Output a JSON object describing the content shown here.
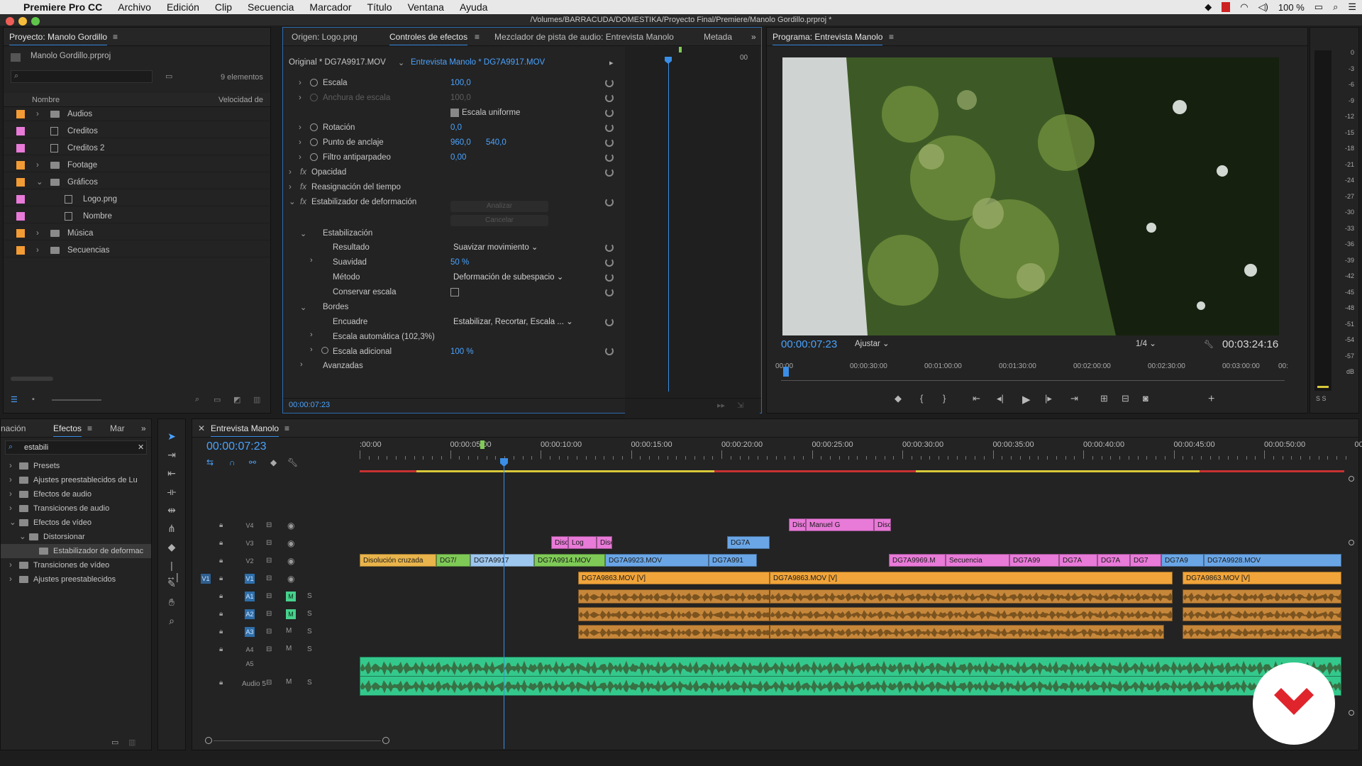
{
  "menubar": {
    "apple": "",
    "app": "Premiere Pro CC",
    "items": [
      "Archivo",
      "Edición",
      "Clip",
      "Secuencia",
      "Marcador",
      "Título",
      "Ventana",
      "Ayuda"
    ],
    "battery": "100 %"
  },
  "window_title": "/Volumes/BARRACUDA/DOMESTIKA/Proyecto Final/Premiere/Manolo Gordillo.prproj *",
  "project": {
    "tab": "Proyecto: Manolo Gordillo",
    "file": "Manolo Gordillo.prproj",
    "count": "9 elementos",
    "col_name": "Nombre",
    "col_speed": "Velocidad de",
    "items": [
      {
        "name": "Audios",
        "color": "#f39b34",
        "type": "folder"
      },
      {
        "name": "Creditos",
        "color": "#e87ad8",
        "type": "seq"
      },
      {
        "name": "Creditos 2",
        "color": "#e87ad8",
        "type": "seq"
      },
      {
        "name": "Footage",
        "color": "#f39b34",
        "type": "folder"
      },
      {
        "name": "Gráficos",
        "color": "#f39b34",
        "type": "folder"
      },
      {
        "name": "Logo.png",
        "color": "#e87ad8",
        "type": "img"
      },
      {
        "name": "Nombre",
        "color": "#e87ad8",
        "type": "seq"
      },
      {
        "name": "Música",
        "color": "#f39b34",
        "type": "folder"
      },
      {
        "name": "Secuencias",
        "color": "#f39b34",
        "type": "folder"
      }
    ]
  },
  "source_tabs": [
    "Origen: Logo.png",
    "Controles de efectos",
    "Mezclador de pista de audio: Entrevista Manolo",
    "Metada"
  ],
  "effects": {
    "master": "Original * DG7A9917.MOV",
    "clip": "Entrevista Manolo * DG7A9917.MOV",
    "rows": [
      {
        "label": "Escala",
        "value": "100,0"
      },
      {
        "label": "Anchura de escala",
        "value": "100,0"
      },
      {
        "label": "Escala uniforme",
        "value": ""
      },
      {
        "label": "Rotación",
        "value": "0,0"
      },
      {
        "label": "Punto de anclaje",
        "value": "960,0",
        "value2": "540,0"
      },
      {
        "label": "Filtro antiparpadeo",
        "value": "0,00"
      },
      {
        "label": "Opacidad",
        "value": ""
      },
      {
        "label": "Reasignación del tiempo",
        "value": ""
      },
      {
        "label": "Estabilizador de deformación",
        "value": ""
      }
    ],
    "analyze": "Analizar",
    "cancel": "Cancelar",
    "stabilization": "Estabilización",
    "result_label": "Resultado",
    "result_value": "Suavizar movimiento",
    "smooth_label": "Suavidad",
    "smooth_value": "50 %",
    "method_label": "Método",
    "method_value": "Deformación de subespacio",
    "keep_scale": "Conservar escala",
    "borders": "Bordes",
    "frame_label": "Encuadre",
    "frame_value": "Estabilizar, Recortar, Escala ...",
    "autoscale": "Escala automática (102,3%)",
    "extra_scale_label": "Escala adicional",
    "extra_scale_value": "100 %",
    "advanced": "Avanzadas",
    "timecode": "00:00:07:23",
    "mini_ruler": "00"
  },
  "program": {
    "tab": "Programa: Entrevista Manolo",
    "timecode": "00:00:07:23",
    "fit": "Ajustar",
    "res": "1/4",
    "duration": "00:03:24:16",
    "ruler": [
      "00:00",
      "00:00:30:00",
      "00:01:00:00",
      "00:01:30:00",
      "00:02:00:00",
      "00:02:30:00",
      "00:03:00:00",
      "00:"
    ]
  },
  "meter": {
    "labels": [
      "0",
      "-3",
      "-6",
      "-9",
      "-12",
      "-15",
      "-18",
      "-21",
      "-24",
      "-27",
      "-30",
      "-33",
      "-36",
      "-39",
      "-42",
      "-45",
      "-48",
      "-51",
      "-54",
      "-57",
      "dB"
    ],
    "bottom": "S S"
  },
  "effects_panel": {
    "tabs": [
      "nación",
      "Efectos",
      "Mar"
    ],
    "search": "estabili",
    "items": [
      {
        "label": "Presets",
        "indent": 0
      },
      {
        "label": "Ajustes preestablecidos de Lu",
        "indent": 0
      },
      {
        "label": "Efectos de audio",
        "indent": 0
      },
      {
        "label": "Transiciones de audio",
        "indent": 0
      },
      {
        "label": "Efectos de vídeo",
        "indent": 0
      },
      {
        "label": "Distorsionar",
        "indent": 1
      },
      {
        "label": "Estabilizador de deformac",
        "indent": 2
      },
      {
        "label": "Transiciones de vídeo",
        "indent": 0
      },
      {
        "label": "Ajustes preestablecidos",
        "indent": 0
      }
    ]
  },
  "timeline": {
    "tab": "Entrevista Manolo",
    "timecode": "00:00:07:23",
    "ruler": [
      ":00:00",
      "00:00:05:00",
      "00:00:10:00",
      "00:00:15:00",
      "00:00:20:00",
      "00:00:25:00",
      "00:00:30:00",
      "00:00:35:00",
      "00:00:40:00",
      "00:00:45:00",
      "00:00:50:00",
      "00"
    ],
    "tracks": [
      "V4",
      "V3",
      "V2",
      "V1",
      "A1",
      "A2",
      "A3",
      "A4",
      "A5"
    ],
    "audio5_name": "Audio 5",
    "v1_source": "V1",
    "clips": {
      "v4_a": "Diso",
      "v4_b": "Manuel G",
      "v4_c": "Diso",
      "v3_a": "Diso",
      "v3_b": "Log",
      "v3_c": "Diso",
      "v3_d": "DG7A",
      "v2": [
        "Disolución cruzada",
        "DG7/",
        "DG7A9917",
        "DG7A9914.MOV",
        "DG7A9923.MOV",
        "DG7A991",
        "DG7A9969.M",
        "Secuencia",
        "DG7A99",
        "DG7A",
        "DG7A",
        "DG7",
        "DG7A9",
        "DG7A9928.MOV"
      ],
      "v1": [
        "DG7A9863.MOV [V]",
        "DG7A9863.MOV [V]",
        "DG7A9863.MOV [V]"
      ]
    }
  },
  "accent": {
    "blue": "#3a8ee6",
    "orange": "#f0a43a",
    "green": "#34c98c",
    "pink": "#e87ad8",
    "lightblue": "#6aa6e6",
    "limegreen": "#7fca57"
  }
}
